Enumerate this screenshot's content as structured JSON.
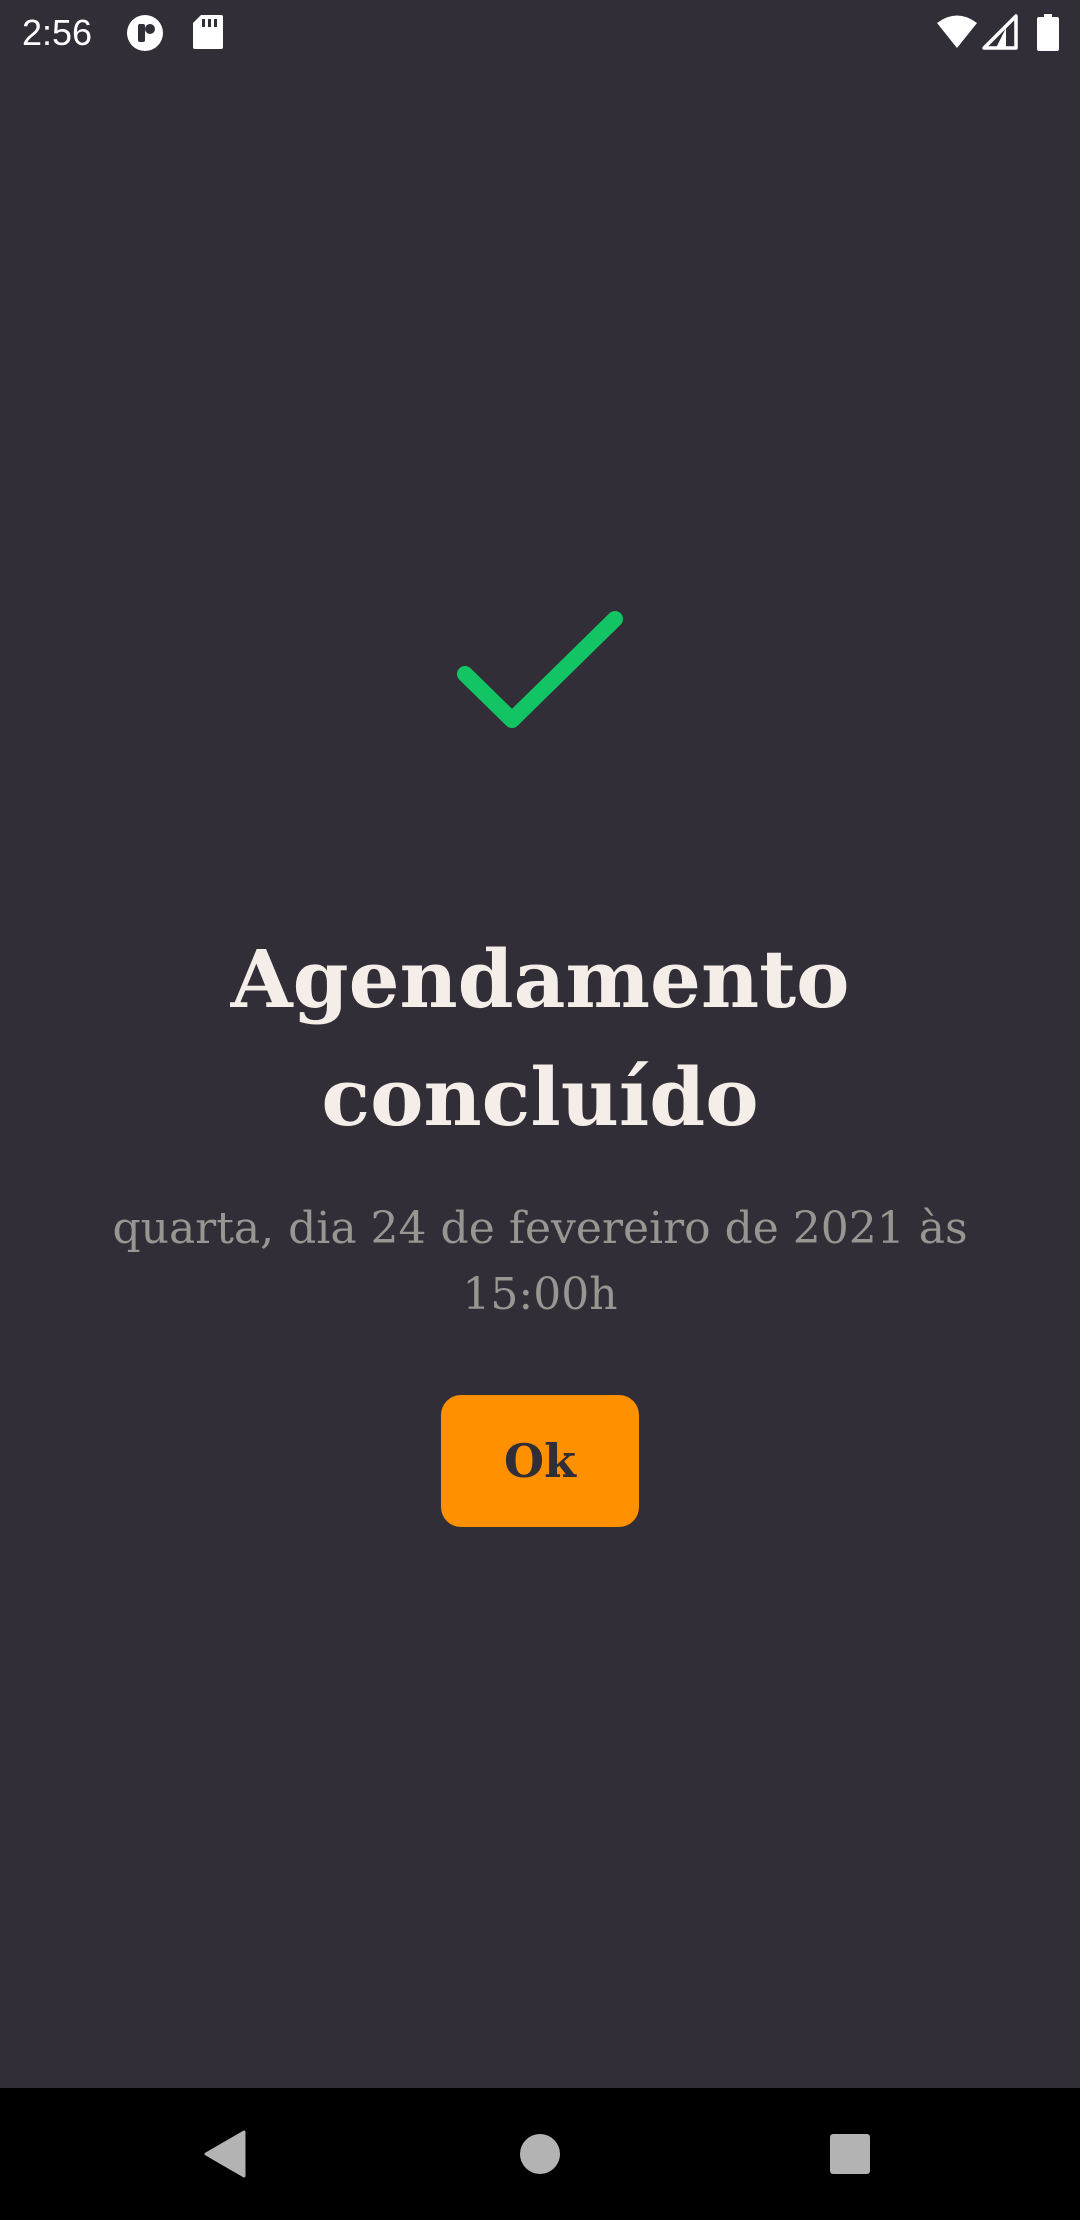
{
  "status_bar": {
    "time": "2:56",
    "icons": [
      "notification-app-icon",
      "sd-card-icon",
      "wifi-icon",
      "cell-signal-icon",
      "battery-icon"
    ]
  },
  "main": {
    "icon": "check-icon",
    "icon_color": "#12c464",
    "title_line1": "Agendamento",
    "title_line2": "concluído",
    "subtitle_line1": "quarta, dia 24 de fevereiro de 2021 às",
    "subtitle_line2": "15:00h",
    "ok_label": "Ok"
  },
  "colors": {
    "background": "#312e38",
    "title": "#f4ede8",
    "subtitle": "#999591",
    "accent": "#ff9000",
    "button_text": "#312e38",
    "nav_bar": "#000000"
  },
  "nav_bar": {
    "buttons": [
      "back-icon",
      "home-icon",
      "recents-icon"
    ]
  }
}
